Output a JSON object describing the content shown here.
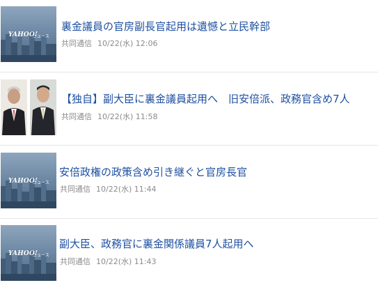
{
  "articles": [
    {
      "headline": "裏金議員の官房副長官起用は遺憾と立民幹部",
      "source": "共同通信",
      "timestamp": "10/22(水) 12:06",
      "thumbnail": "yahoo-news-logo",
      "thumbnail_logo": "YAHOO!",
      "thumbnail_logo_sub": "ニュース"
    },
    {
      "headline": "【独自】副大臣に裏金議員起用へ　旧安倍派、政務官含め7人",
      "source": "共同通信",
      "timestamp": "10/22(水) 11:58",
      "thumbnail": "politician-portraits"
    },
    {
      "headline": "安倍政権の政策含め引き継ぐと官房長官",
      "source": "共同通信",
      "timestamp": "10/22(水) 11:44",
      "thumbnail": "yahoo-news-logo",
      "thumbnail_logo": "YAHOO!",
      "thumbnail_logo_sub": "ニュース"
    },
    {
      "headline": "副大臣、政務官に裏金関係議員7人起用へ",
      "source": "共同通信",
      "timestamp": "10/22(水) 11:43",
      "thumbnail": "yahoo-news-logo",
      "thumbnail_logo": "YAHOO!",
      "thumbnail_logo_sub": "ニュース"
    }
  ],
  "colors": {
    "headline": "#1e50a2",
    "meta": "#8b8b8b",
    "divider": "#e6e6e6"
  }
}
